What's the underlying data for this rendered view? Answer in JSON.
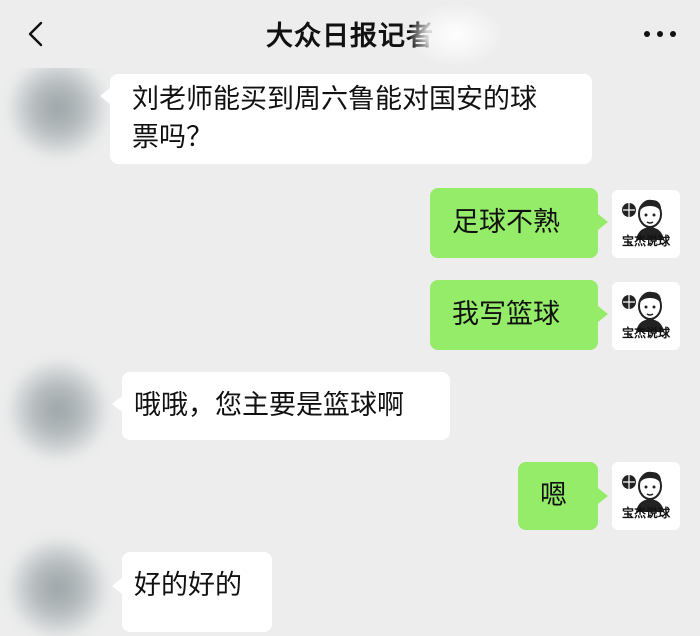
{
  "header": {
    "title": "大众日报记者",
    "back_icon": "chevron-left-icon",
    "more_icon": "more-dots-icon"
  },
  "messages": [
    {
      "side": "left",
      "text_line1": "刘老师能买到周六鲁能对国安的球",
      "text_line2": "票吗？"
    },
    {
      "side": "right",
      "text": "足球不熟"
    },
    {
      "side": "right",
      "text": "我写篮球"
    },
    {
      "side": "left",
      "text": "哦哦，您主要是篮球啊"
    },
    {
      "side": "right",
      "text": "嗯"
    },
    {
      "side": "left",
      "text": "好的好的"
    }
  ],
  "my_avatar": {
    "logo_text": "宝杰说球",
    "icon": "cartoon-man-basketball-icon"
  },
  "colors": {
    "background": "#ededed",
    "bubble_sent": "#95ec69",
    "bubble_received": "#ffffff"
  }
}
